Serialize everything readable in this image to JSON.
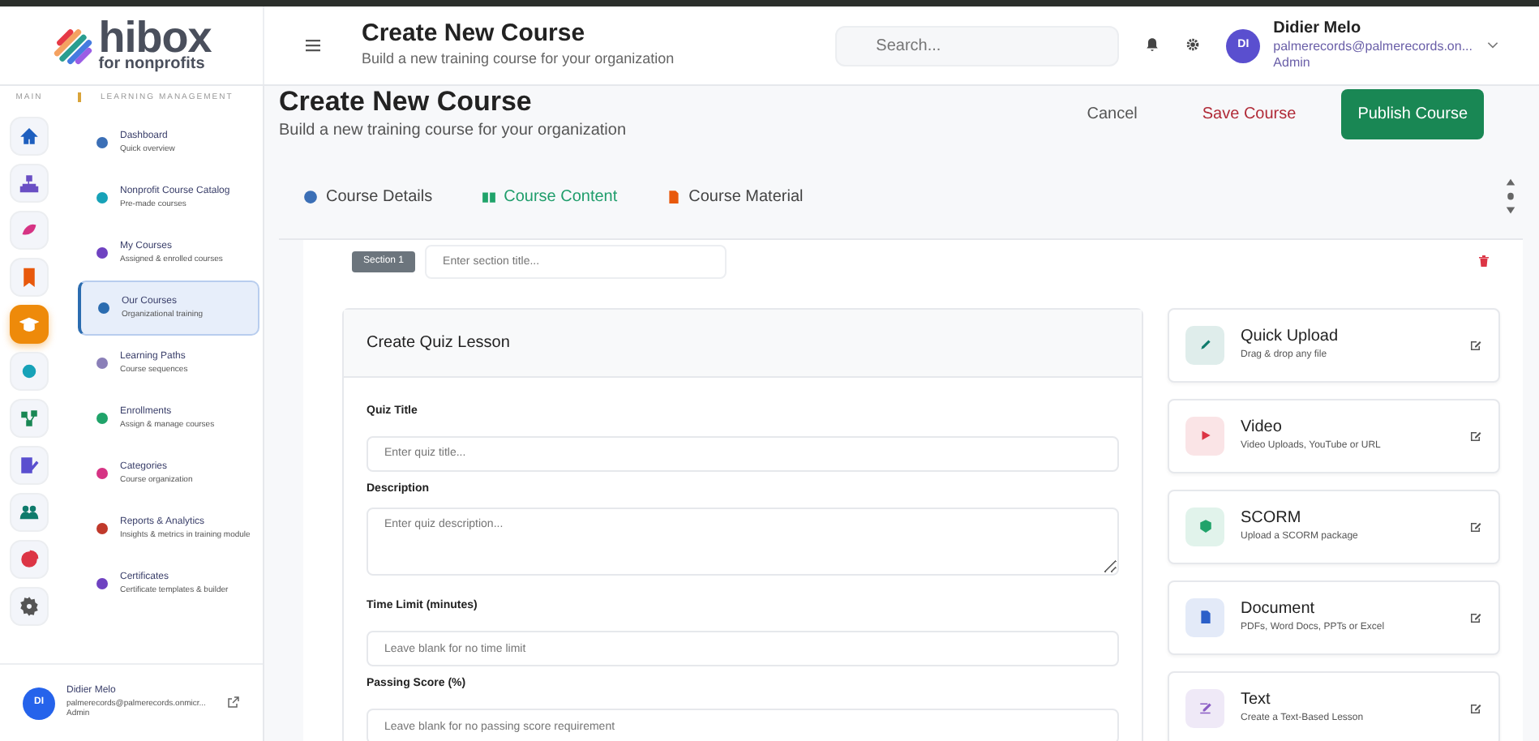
{
  "logo": {
    "name": "hibox",
    "tagline": "for nonprofits"
  },
  "header": {
    "title": "Create New Course",
    "subtitle": "Build a new training course for your organization",
    "search": {
      "placeholder": "Search..."
    },
    "user": {
      "initials": "DI",
      "name": "Didier Melo",
      "email": "palmerecords@palmerecords.on...",
      "role": "Admin"
    }
  },
  "rail": {
    "label": "MAIN",
    "items": [
      {
        "color": "#1e5fbf",
        "selected": false
      },
      {
        "color": "#6a4fc4",
        "selected": false
      },
      {
        "color": "#d63384",
        "selected": false
      },
      {
        "color": "#e8590c",
        "selected": false
      },
      {
        "color": "#ffffff",
        "selected": true
      },
      {
        "color": "#17a2b8",
        "selected": false
      },
      {
        "color": "#198754",
        "selected": false
      },
      {
        "color": "#5a4fcf",
        "selected": false
      },
      {
        "color": "#0f7b6c",
        "selected": false
      },
      {
        "color": "#dc3545",
        "selected": false
      },
      {
        "color": "#555555",
        "selected": false
      }
    ]
  },
  "menu": {
    "label": "LEARNING MANAGEMENT",
    "items": [
      {
        "title": "Dashboard",
        "subtitle": "Quick overview",
        "color": "#3b6fb6",
        "selected": false
      },
      {
        "title": "Nonprofit Course Catalog",
        "subtitle": "Pre-made courses",
        "color": "#17a2b8",
        "selected": false
      },
      {
        "title": "My Courses",
        "subtitle": "Assigned & enrolled courses",
        "color": "#6f42c1",
        "selected": false
      },
      {
        "title": "Our Courses",
        "subtitle": "Organizational training",
        "color": "#2b6cb0",
        "selected": true
      },
      {
        "title": "Learning Paths",
        "subtitle": "Course sequences",
        "color": "#8a7fb8",
        "selected": false
      },
      {
        "title": "Enrollments",
        "subtitle": "Assign & manage courses",
        "color": "#20a36a",
        "selected": false
      },
      {
        "title": "Categories",
        "subtitle": "Course organization",
        "color": "#d63384",
        "selected": false
      },
      {
        "title": "Reports & Analytics",
        "subtitle": "Insights & metrics in training module",
        "color": "#c0392b",
        "selected": false
      },
      {
        "title": "Certificates",
        "subtitle": "Certificate templates & builder",
        "color": "#6f42c1",
        "selected": false
      }
    ]
  },
  "sidebar_user": {
    "initials": "DI",
    "name": "Didier Melo",
    "email": "palmerecords@palmerecords.onmicr...",
    "role": "Admin"
  },
  "page": {
    "title": "Create New Course",
    "subtitle": "Build a new training course for your organization",
    "buttons": [
      {
        "label": "Cancel",
        "kind": "plain"
      },
      {
        "label": "Save Course",
        "kind": "danger-text"
      },
      {
        "label": "Publish Course",
        "kind": "primary"
      }
    ]
  },
  "tabs": [
    {
      "label": "Course Details",
      "color": "#3b6fb6",
      "selected": false
    },
    {
      "label": "Course Content",
      "color": "#20a36a",
      "selected": true
    },
    {
      "label": "Course Material",
      "color": "#e8590c",
      "selected": false
    }
  ],
  "section": {
    "badge": "Section 1",
    "placeholder": "Enter section title..."
  },
  "quiz": {
    "title": "Create Quiz Lesson",
    "fields": [
      {
        "label": "Quiz Title",
        "placeholder": "Enter quiz title...",
        "kind": "input"
      },
      {
        "label": "Description",
        "placeholder": "Enter quiz description...",
        "kind": "textarea"
      },
      {
        "label": "Time Limit (minutes)",
        "placeholder": "Leave blank for no time limit",
        "kind": "input"
      },
      {
        "label": "Passing Score (%)",
        "placeholder": "Leave blank for no passing score requirement",
        "kind": "input"
      }
    ]
  },
  "lesson_types": [
    {
      "title": "Quick Upload",
      "subtitle": "Drag & drop any file",
      "color": "#0f7b6c"
    },
    {
      "title": "Video",
      "subtitle": "Video Uploads, YouTube or URL",
      "color": "#dc3545"
    },
    {
      "title": "SCORM",
      "subtitle": "Upload a SCORM package",
      "color": "#20a36a"
    },
    {
      "title": "Document",
      "subtitle": "PDFs, Word Docs, PPTs or Excel",
      "color": "#2b5fc9"
    },
    {
      "title": "Text",
      "subtitle": "Create a Text-Based Lesson",
      "color": "#8a5cc4"
    }
  ]
}
